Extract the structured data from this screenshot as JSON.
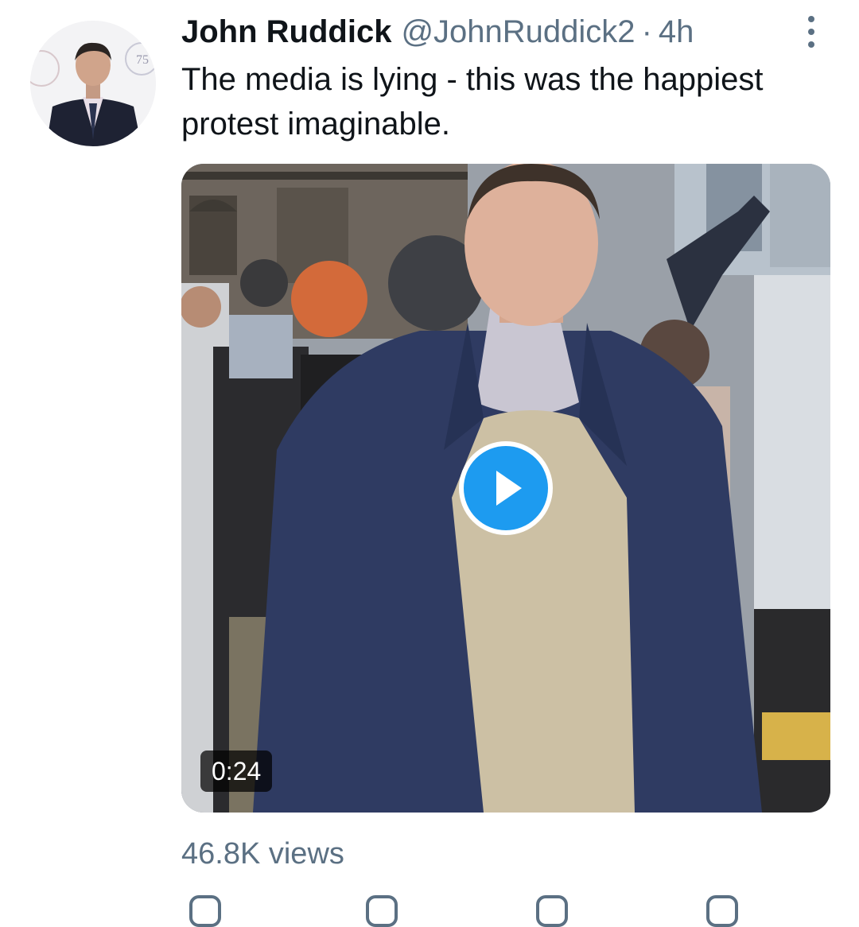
{
  "author": {
    "name": "John Ruddick",
    "handle": "@JohnRuddick2",
    "separator": "·",
    "time": "4h"
  },
  "tweet": {
    "text": "The media is lying - this was the happiest protest imaginable."
  },
  "media": {
    "type": "video",
    "duration": "0:24",
    "play_icon": "play-icon"
  },
  "stats": {
    "views": "46.8K views"
  },
  "icons": {
    "more": "more-options-icon",
    "reply": "reply-icon",
    "retweet": "retweet-icon",
    "like": "like-icon",
    "share": "share-icon"
  },
  "colors": {
    "text": "#0f1419",
    "secondary": "#5b7083",
    "accent": "#1d9bf0"
  }
}
